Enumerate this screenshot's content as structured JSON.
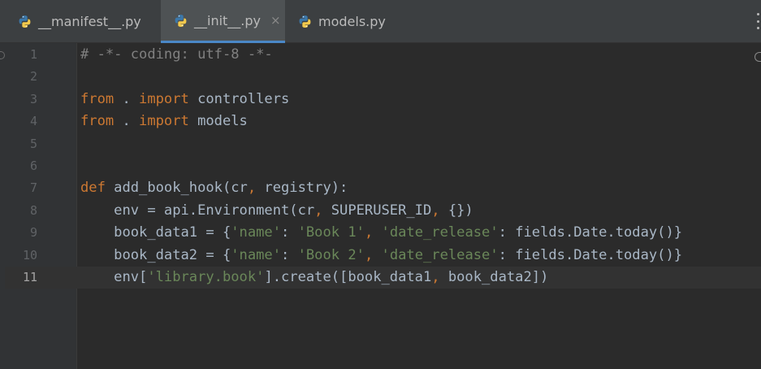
{
  "tabs": [
    {
      "label": "__manifest__.py",
      "icon": "python-file-icon",
      "active": false
    },
    {
      "label": "__init__.py",
      "icon": "python-file-icon",
      "active": true,
      "close": "×"
    },
    {
      "label": "models.py",
      "icon": "python-file-icon",
      "active": false
    }
  ],
  "colors": {
    "keyword": "#cc7832",
    "string": "#6a8759",
    "comment": "#808080",
    "text": "#a9b7c6",
    "accent": "#4a88c7"
  },
  "lines": [
    {
      "number": "1",
      "tokens": [
        {
          "type": "cm",
          "text": "# -*- coding: utf-8 -*-"
        }
      ]
    },
    {
      "number": "2",
      "tokens": []
    },
    {
      "number": "3",
      "tokens": [
        {
          "type": "kw",
          "text": "from"
        },
        {
          "type": "tx",
          "text": " . "
        },
        {
          "type": "kw",
          "text": "import"
        },
        {
          "type": "tx",
          "text": " controllers"
        }
      ]
    },
    {
      "number": "4",
      "tokens": [
        {
          "type": "kw",
          "text": "from"
        },
        {
          "type": "tx",
          "text": " . "
        },
        {
          "type": "kw",
          "text": "import"
        },
        {
          "type": "tx",
          "text": " models"
        }
      ]
    },
    {
      "number": "5",
      "tokens": []
    },
    {
      "number": "6",
      "tokens": []
    },
    {
      "number": "7",
      "tokens": [
        {
          "type": "kw",
          "text": "def"
        },
        {
          "type": "tx",
          "text": " add_book_hook(cr"
        },
        {
          "type": "kw",
          "text": ","
        },
        {
          "type": "tx",
          "text": " registry):"
        }
      ]
    },
    {
      "number": "8",
      "tokens": [
        {
          "type": "tx",
          "text": "    env = api.Environment(cr"
        },
        {
          "type": "kw",
          "text": ","
        },
        {
          "type": "tx",
          "text": " SUPERUSER_ID"
        },
        {
          "type": "kw",
          "text": ","
        },
        {
          "type": "tx",
          "text": " {})"
        }
      ]
    },
    {
      "number": "9",
      "tokens": [
        {
          "type": "tx",
          "text": "    book_data1 = {"
        },
        {
          "type": "str",
          "text": "'name'"
        },
        {
          "type": "tx",
          "text": ": "
        },
        {
          "type": "str",
          "text": "'Book 1'"
        },
        {
          "type": "kw",
          "text": ","
        },
        {
          "type": "tx",
          "text": " "
        },
        {
          "type": "str",
          "text": "'date_release'"
        },
        {
          "type": "tx",
          "text": ": fields.Date.today()}"
        }
      ]
    },
    {
      "number": "10",
      "tokens": [
        {
          "type": "tx",
          "text": "    book_data2 = {"
        },
        {
          "type": "str",
          "text": "'name'"
        },
        {
          "type": "tx",
          "text": ": "
        },
        {
          "type": "str",
          "text": "'Book 2'"
        },
        {
          "type": "kw",
          "text": ","
        },
        {
          "type": "tx",
          "text": " "
        },
        {
          "type": "str",
          "text": "'date_release'"
        },
        {
          "type": "tx",
          "text": ": fields.Date.today()}"
        }
      ]
    },
    {
      "number": "11",
      "current": true,
      "tokens": [
        {
          "type": "tx",
          "text": "    env["
        },
        {
          "type": "str",
          "text": "'library.book'"
        },
        {
          "type": "tx",
          "text": "].create([book_data1"
        },
        {
          "type": "kw",
          "text": ","
        },
        {
          "type": "tx",
          "text": " book_data2])"
        }
      ]
    }
  ]
}
